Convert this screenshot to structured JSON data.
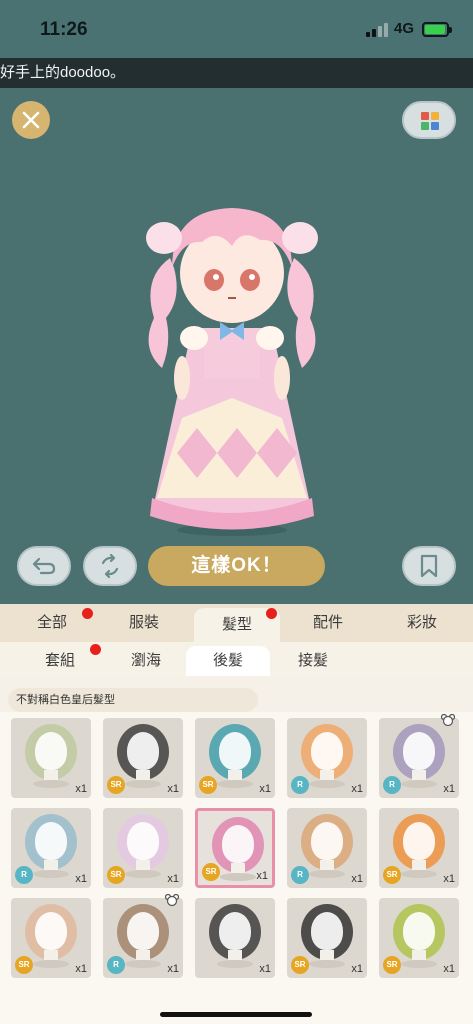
{
  "status_bar": {
    "time": "11:26",
    "network": "4G"
  },
  "ticker": {
    "text": "好手上的doodoo。"
  },
  "toolbar": {
    "ok_label": "這樣OK！"
  },
  "tabs": [
    {
      "label": "全部",
      "dot": true
    },
    {
      "label": "服裝",
      "dot": false
    },
    {
      "label": "髮型",
      "dot": true,
      "active": true
    },
    {
      "label": "配件",
      "dot": false
    },
    {
      "label": "彩妝",
      "dot": false
    }
  ],
  "subtabs": [
    {
      "label": "套組",
      "dot": true
    },
    {
      "label": "瀏海",
      "dot": false
    },
    {
      "label": "後髮",
      "active": true
    },
    {
      "label": "接髮",
      "dot": false
    }
  ],
  "filter": {
    "label": "不對稱白色皇后髮型"
  },
  "items": [
    {
      "rarity": "",
      "count": "x1",
      "hair_color": "#b9c79a"
    },
    {
      "rarity": "SR",
      "count": "x1",
      "hair_color": "#2b2b2b"
    },
    {
      "rarity": "SR",
      "count": "x1",
      "hair_color": "#2e9aa8"
    },
    {
      "rarity": "R",
      "count": "x1",
      "hair_color": "#f2a25a"
    },
    {
      "rarity": "R",
      "count": "x1",
      "hair_color": "#9b8fb8"
    },
    {
      "rarity": "R",
      "count": "x1",
      "hair_color": "#8fb8cc"
    },
    {
      "rarity": "SR",
      "count": "x1",
      "hair_color": "#e6c6e6"
    },
    {
      "rarity": "SR",
      "count": "x1",
      "hair_color": "#e07aa9",
      "selected": true
    },
    {
      "rarity": "R",
      "count": "x1",
      "hair_color": "#d9a06b"
    },
    {
      "rarity": "SR",
      "count": "x1",
      "hair_color": "#f08a2c"
    },
    {
      "rarity": "SR",
      "count": "x1",
      "hair_color": "#e0b597"
    },
    {
      "rarity": "R",
      "count": "x1",
      "hair_color": "#9a7a5e"
    },
    {
      "rarity": "",
      "count": "x1",
      "hair_color": "#2a2a2a"
    },
    {
      "rarity": "SR",
      "count": "x1",
      "hair_color": "#1e1e1e"
    },
    {
      "rarity": "SR",
      "count": "x1",
      "hair_color": "#a8c23c"
    }
  ],
  "colors": {
    "stage_bg": "#4b7070",
    "accent_gold": "#c9a85f",
    "tab_bg": "#ece2cf",
    "badge_sr": "#e6a623",
    "badge_r": "#58b6c4",
    "notification_dot": "#e8201c"
  }
}
